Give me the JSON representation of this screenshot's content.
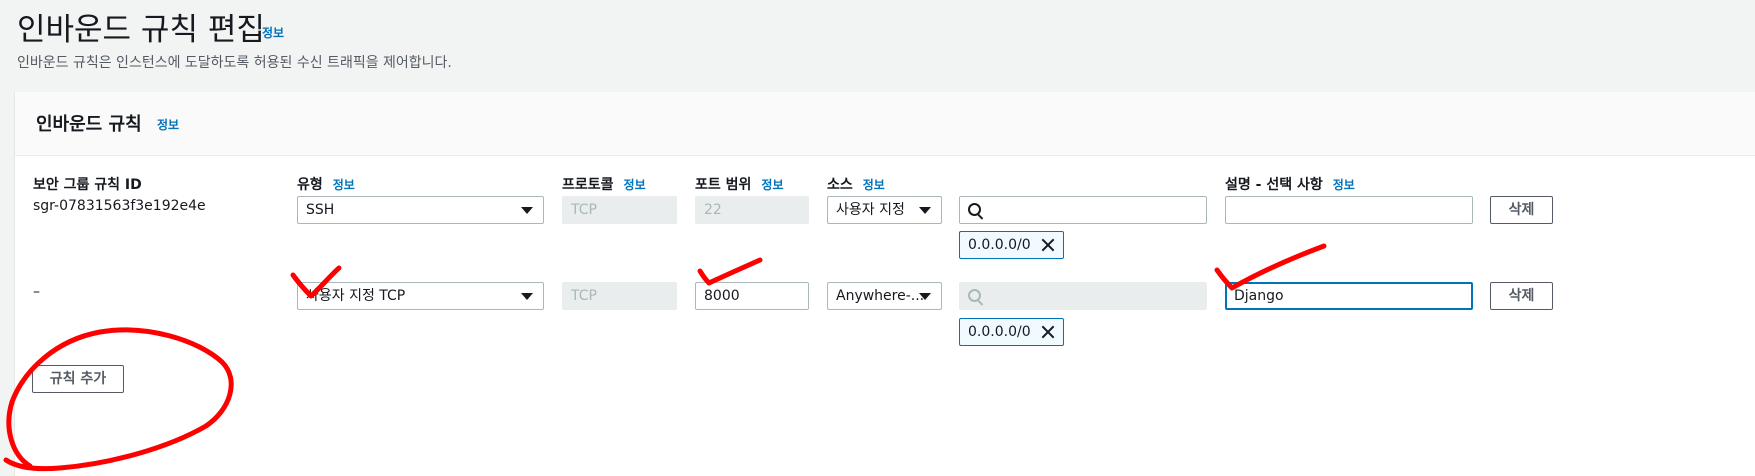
{
  "page": {
    "title": "인바운드 규칙 편집",
    "title_info": "정보",
    "description": "인바운드 규칙은 인스턴스에 도달하도록 허용된 수신 트래픽을 제어합니다."
  },
  "panel": {
    "title": "인바운드 규칙",
    "title_info": "정보"
  },
  "columns": {
    "rule_id": "보안 그룹 규칙 ID",
    "type": "유형",
    "protocol": "프로토콜",
    "port_range": "포트 범위",
    "source": "소스",
    "description": "설명 - 선택 사항",
    "info": "정보"
  },
  "rules": [
    {
      "rule_id": "sgr-07831563f3e192e4e",
      "type": "SSH",
      "protocol": "TCP",
      "port_range": "22",
      "source_type": "사용자 지정",
      "source_search": "",
      "cidr_token": "0.0.0.0/0",
      "description": "",
      "delete_label": "삭제"
    },
    {
      "rule_id": "–",
      "type": "사용자 지정 TCP",
      "protocol": "TCP",
      "port_range": "8000",
      "source_type": "Anywhere-...",
      "source_search": "",
      "cidr_token": "0.0.0.0/0",
      "description": "Django",
      "delete_label": "삭제"
    }
  ],
  "add_rule_label": "규칙 추가",
  "colors": {
    "link": "#0073bb",
    "annotation": "#ff0000",
    "focus": "#0073bb"
  }
}
